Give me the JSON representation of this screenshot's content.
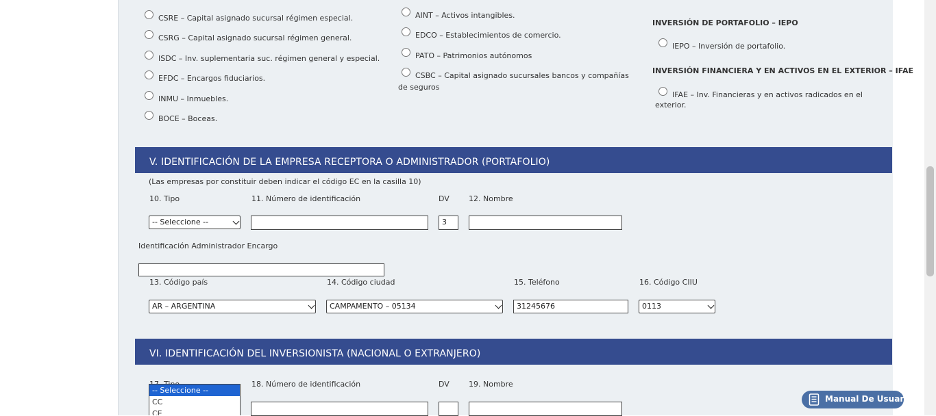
{
  "section_iv": {
    "col1": [
      "CSRE – Capital asignado sucursal régimen especial.",
      "CSRG – Capital asignado sucursal régimen general.",
      "ISDC – Inv. suplementaria suc. régimen general y especial.",
      "EFDC – Encargos fiduciarios.",
      "INMU – Inmuebles.",
      "BOCE – Boceas."
    ],
    "col2": [
      "AINT – Activos intangibles.",
      "EDCO – Establecimientos de comercio.",
      "PATO – Patrimonios autónomos",
      "CSBC – Capital asignado sucursales bancos y compañías",
      "de seguros"
    ],
    "col3": {
      "heading_portfolio": "INVERSIÓN DE PORTAFOLIO – IEPO",
      "iepo": "IEPO – Inversión de portafolio.",
      "heading_financial": "INVERSIÓN FINANCIERA Y EN ACTIVOS EN EL EXTERIOR – IFAE",
      "ifae_line1": "IFAE – Inv. Financieras y en activos radicados en el",
      "ifae_line2": "exterior."
    }
  },
  "section_v": {
    "title": "V. IDENTIFICACIÓN DE LA EMPRESA RECEPTORA O ADMINISTRADOR (PORTAFOLIO)",
    "note": "(Las empresas por constituir deben indicar el código EC en la casilla 10)",
    "tipo_label": "10. Tipo",
    "tipo_value": "-- Seleccione --",
    "numero_label": "11. Número de identificación",
    "numero_value": "",
    "dv_label": "DV",
    "dv_value": "3",
    "nombre_label": "12. Nombre",
    "nombre_value": "",
    "admin_label": "Identificación Administrador Encargo",
    "admin_value": "",
    "pais_label": "13. Código país",
    "pais_value": "AR – ARGENTINA",
    "ciudad_label": "14. Código ciudad",
    "ciudad_value": "CAMPAMENTO – 05134",
    "telefono_label": "15. Teléfono",
    "telefono_value": "31245676",
    "ciiu_label": "16. Código CIIU",
    "ciiu_value": "0113"
  },
  "section_vi": {
    "title": "VI. IDENTIFICACIÓN DEL INVERSIONISTA (NACIONAL O EXTRANJERO)",
    "tipo_label": "17. Tipo",
    "tipo_options": [
      "-- Seleccione --",
      "CC",
      "CE"
    ],
    "numero_label": "18. Número de identificación",
    "dv_label": "DV",
    "nombre_label": "19. Nombre"
  },
  "help": {
    "manual_label": "Manual De Usuario",
    "icon": "manual-icon"
  },
  "colors": {
    "band": "#354c8f",
    "panel": "#ecf0f3",
    "manual_button": "#4a6fa5",
    "dropdown_highlight": "#1e64d2"
  }
}
